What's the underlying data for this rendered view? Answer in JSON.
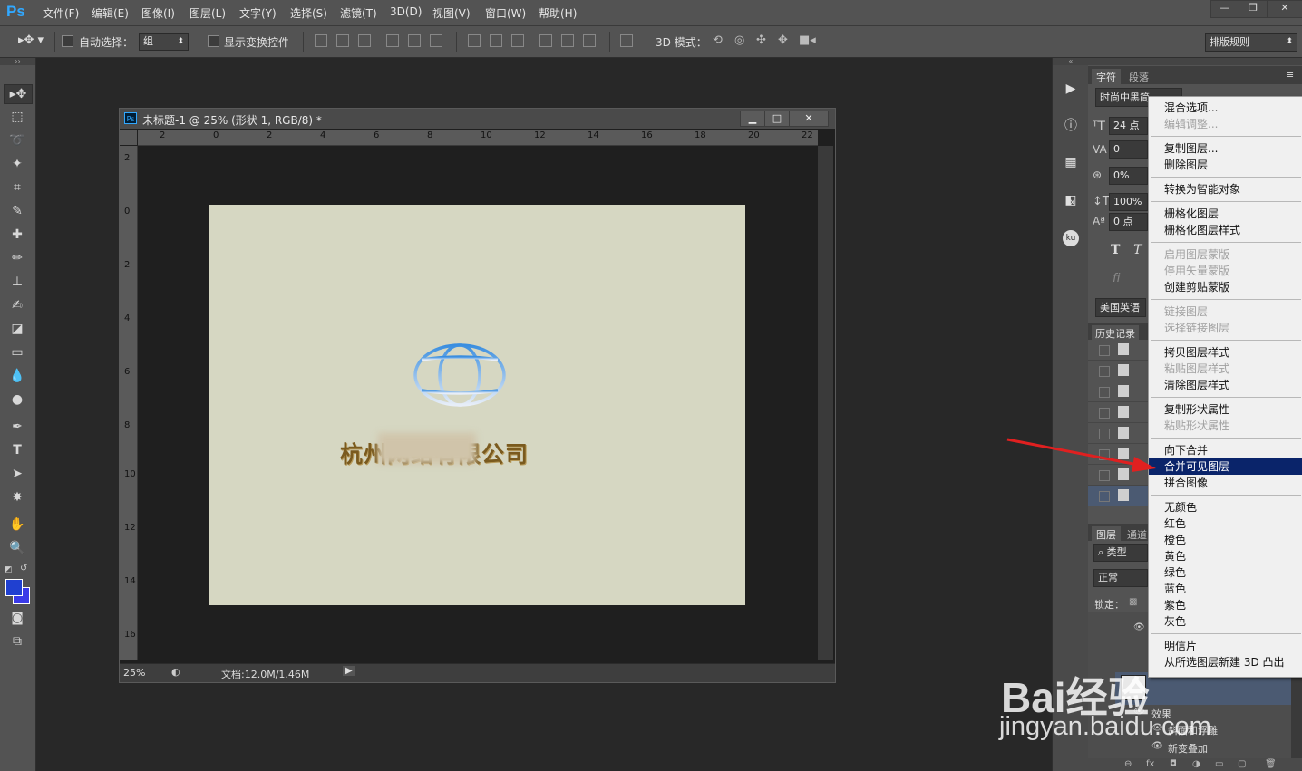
{
  "menubar": {
    "logo": "Ps",
    "items": [
      "文件(F)",
      "编辑(E)",
      "图像(I)",
      "图层(L)",
      "文字(Y)",
      "选择(S)",
      "滤镜(T)",
      "3D(D)",
      "视图(V)",
      "窗口(W)",
      "帮助(H)"
    ],
    "window_buttons": [
      "—",
      "❐",
      "✕"
    ]
  },
  "options_bar": {
    "auto_select_label": "自动选择：",
    "auto_select_value": "组",
    "show_transform_label": "显示变换控件",
    "mode_3d_label": "3D 模式：",
    "workspace_value": "排版规则"
  },
  "document": {
    "title": "未标题-1 @ 25% (形状 1, RGB/8) *",
    "ruler_top": [
      "2",
      "0",
      "2",
      "4",
      "6",
      "8",
      "10",
      "12",
      "14",
      "16",
      "18",
      "20",
      "22"
    ],
    "ruler_left": [
      "2",
      "0",
      "2",
      "4",
      "6",
      "8",
      "10",
      "12",
      "14",
      "16"
    ],
    "zoom": "25%",
    "doc_info": "文档:12.0M/1.46M",
    "company_text": "杭州网络有限公司"
  },
  "character_panel": {
    "tabs": [
      "字符",
      "段落"
    ],
    "font": "时尚中黑简",
    "size": "24 点",
    "tracking": "0",
    "scale": "0%",
    "vertical_scale": "100%",
    "baseline": "0 点",
    "language": "美国英语"
  },
  "history_panel": {
    "title": "历史记录",
    "rows": 8
  },
  "layers_panel": {
    "tabs": [
      "图层",
      "通道"
    ],
    "filter": "类型",
    "blend_mode": "正常",
    "lock_label": "锁定：",
    "effects_label": "效果",
    "effects": [
      "斜面和浮雕",
      "新变叠加"
    ]
  },
  "context_menu": {
    "groups": [
      [
        {
          "label": "混合选项...",
          "enabled": true
        },
        {
          "label": "编辑调整...",
          "enabled": false
        }
      ],
      [
        {
          "label": "复制图层...",
          "enabled": true
        },
        {
          "label": "删除图层",
          "enabled": true
        }
      ],
      [
        {
          "label": "转换为智能对象",
          "enabled": true
        }
      ],
      [
        {
          "label": "栅格化图层",
          "enabled": true
        },
        {
          "label": "栅格化图层样式",
          "enabled": true
        }
      ],
      [
        {
          "label": "启用图层蒙版",
          "enabled": false
        },
        {
          "label": "停用矢量蒙版",
          "enabled": false
        },
        {
          "label": "创建剪贴蒙版",
          "enabled": true
        }
      ],
      [
        {
          "label": "链接图层",
          "enabled": false
        },
        {
          "label": "选择链接图层",
          "enabled": false
        }
      ],
      [
        {
          "label": "拷贝图层样式",
          "enabled": true
        },
        {
          "label": "粘贴图层样式",
          "enabled": false
        },
        {
          "label": "清除图层样式",
          "enabled": true
        }
      ],
      [
        {
          "label": "复制形状属性",
          "enabled": true
        },
        {
          "label": "粘贴形状属性",
          "enabled": false
        }
      ],
      [
        {
          "label": "向下合并",
          "enabled": true
        },
        {
          "label": "合并可见图层",
          "enabled": true,
          "selected": true
        },
        {
          "label": "拼合图像",
          "enabled": true
        }
      ],
      [
        {
          "label": "无颜色",
          "enabled": true
        },
        {
          "label": "红色",
          "enabled": true
        },
        {
          "label": "橙色",
          "enabled": true
        },
        {
          "label": "黄色",
          "enabled": true
        },
        {
          "label": "绿色",
          "enabled": true
        },
        {
          "label": "蓝色",
          "enabled": true
        },
        {
          "label": "紫色",
          "enabled": true
        },
        {
          "label": "灰色",
          "enabled": true
        }
      ],
      [
        {
          "label": "明信片",
          "enabled": true
        },
        {
          "label": "从所选图层新建 3D 凸出",
          "enabled": true
        }
      ]
    ]
  },
  "watermark": {
    "logo_text": "Bai经验",
    "url": "jingyan.baidu.com"
  },
  "colors": {
    "canvas": "#d6d7c2",
    "company_text": "#7a5a1e",
    "selection": "#0a246a",
    "foreground": "#2040d0",
    "arrow": "#e02020"
  }
}
